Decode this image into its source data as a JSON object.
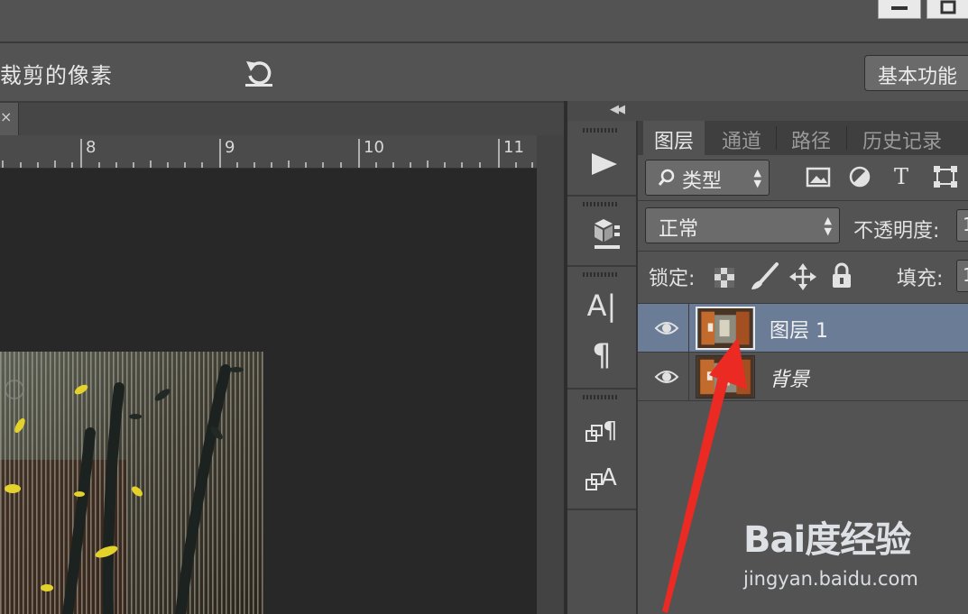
{
  "options_bar": {
    "crop_label": "裁剪的像素",
    "workspace_button": "基本功能"
  },
  "ruler": {
    "ticks": [
      "8",
      "9",
      "10",
      "11"
    ]
  },
  "layers_panel": {
    "tabs": [
      {
        "label": "图层",
        "active": true
      },
      {
        "label": "通道",
        "active": false
      },
      {
        "label": "路径",
        "active": false
      },
      {
        "label": "历史记录",
        "active": false
      }
    ],
    "filter": {
      "kind_label": "类型"
    },
    "blend_mode": "正常",
    "opacity_label": "不透明度:",
    "opacity_value": "1",
    "lock_label": "锁定:",
    "fill_label": "填充:",
    "fill_value": "1",
    "layers": [
      {
        "name": "图层 1",
        "selected": true
      },
      {
        "name": "背景",
        "selected": false
      }
    ]
  },
  "side_tools": {
    "char_icon": "A|",
    "para_icon": "¶"
  },
  "watermark": {
    "logo_text": "Bai度经验",
    "url": "jingyan.baidu.com"
  },
  "colors": {
    "selected_layer": "#6a7c96",
    "arrow": "#ea2a23",
    "panel_bg": "#535353",
    "canvas_bg": "#282828"
  }
}
